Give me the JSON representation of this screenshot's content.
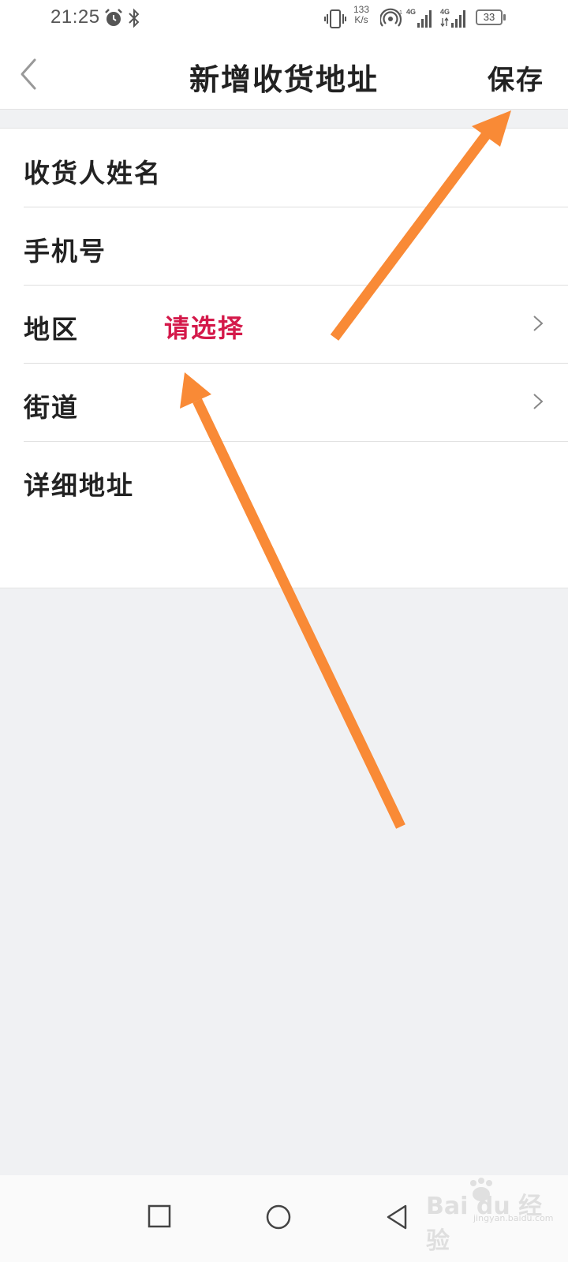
{
  "status_bar": {
    "time": "21:25",
    "net_speed_value": "133",
    "net_speed_unit": "K/s",
    "battery": "33"
  },
  "nav": {
    "title": "新增收货地址",
    "save_label": "保存"
  },
  "form": {
    "rows": [
      {
        "label": "收货人姓名",
        "value": ""
      },
      {
        "label": "手机号",
        "value": ""
      },
      {
        "label": "地区",
        "value": "请选择"
      },
      {
        "label": "街道",
        "value": ""
      },
      {
        "label": "详细地址",
        "value": ""
      }
    ]
  },
  "watermark": {
    "text": "Bai du 经验",
    "sub": "jingyan.baidu.com"
  },
  "colors": {
    "accent_red": "#d4194a",
    "arrow_orange": "#f98a36",
    "page_bg": "#f0f1f3"
  }
}
